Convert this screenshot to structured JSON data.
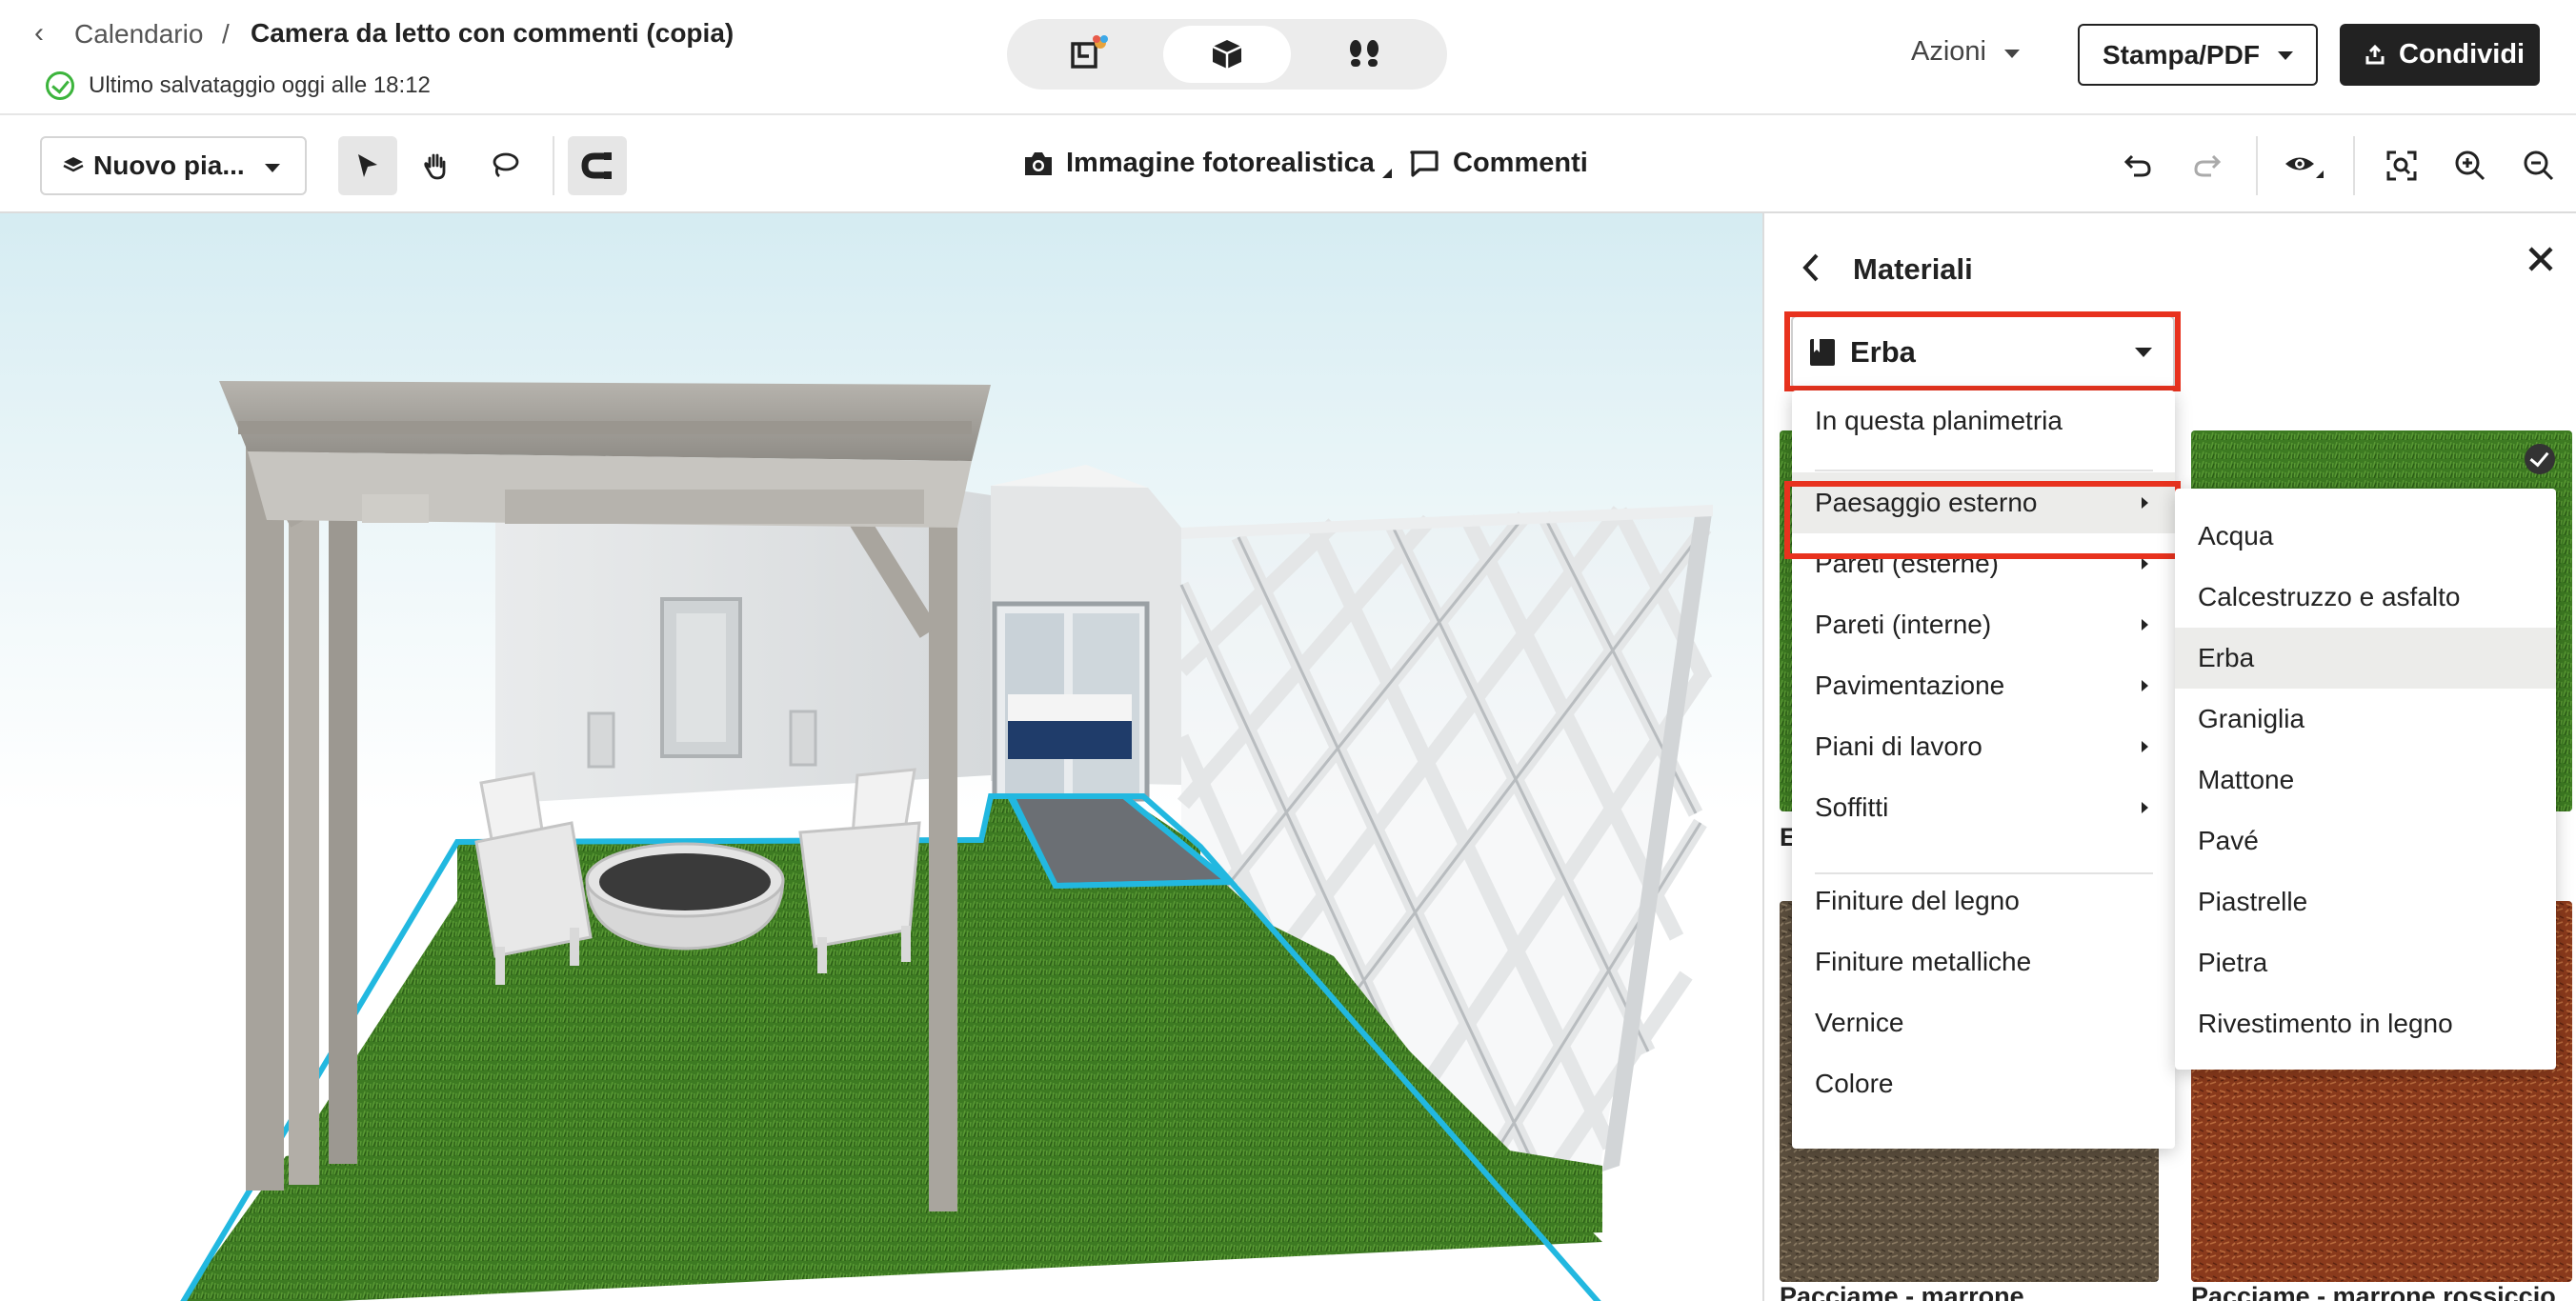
{
  "header": {
    "breadcrumb_parent": "Calendario",
    "breadcrumb_sep": "/",
    "title": "Camera da letto con commenti (copia)",
    "save_status": "Ultimo salvataggio oggi alle 18:12",
    "view_modes": [
      {
        "name": "2d-plan-icon",
        "active": false
      },
      {
        "name": "3d-box-icon",
        "active": true
      },
      {
        "name": "walkthrough-footsteps-icon",
        "active": false
      }
    ],
    "actions_label": "Azioni",
    "print_label": "Stampa/PDF",
    "share_label": "Condividi"
  },
  "toolbar": {
    "layer_select": "Nuovo pia...",
    "photo_label": "Immagine fotorealistica",
    "comments_label": "Comment i"
  },
  "panel": {
    "title": "Materiali",
    "category_selected": "Erba",
    "menu": {
      "items": [
        {
          "label": "In questa planimetria",
          "submenu": false
        },
        {
          "label": "Paesaggio esterno",
          "submenu": true,
          "highlighted": true
        },
        {
          "label": "Pareti (esterne)",
          "submenu": true
        },
        {
          "label": "Pareti (interne)",
          "submenu": true
        },
        {
          "label": "Pavimentazione",
          "submenu": true
        },
        {
          "label": "Piani di lavoro",
          "submenu": true
        },
        {
          "label": "Soffitti",
          "submenu": true
        },
        {
          "label": "Finiture del legno",
          "submenu": false
        },
        {
          "label": "Finiture metalliche",
          "submenu": false
        },
        {
          "label": "Vernice",
          "submenu": false
        },
        {
          "label": "Colore",
          "submenu": false
        }
      ]
    },
    "submenu": {
      "items": [
        "Acqua",
        "Calcestruzzo e asfalto",
        "Erba",
        "Graniglia",
        "Mattone",
        "Pavé",
        "Piastrelle",
        "Pietra",
        "Rivestimento in legno"
      ],
      "highlighted": "Erba"
    },
    "thumbnails": [
      {
        "label": "E",
        "color": "#4a7a2a"
      },
      {
        "label": "",
        "color": "#3f7a26",
        "selected": true
      },
      {
        "label": "Pacciame - marrone",
        "color": "#5c4f3e"
      },
      {
        "label": "Pacciame - marrone rossiccio",
        "color": "#8a3a1c"
      }
    ]
  },
  "colors": {
    "accent_red": "#e8321e",
    "selection_cyan": "#22b8e0",
    "grass": "#3d7a22",
    "dark_button": "#222222"
  }
}
